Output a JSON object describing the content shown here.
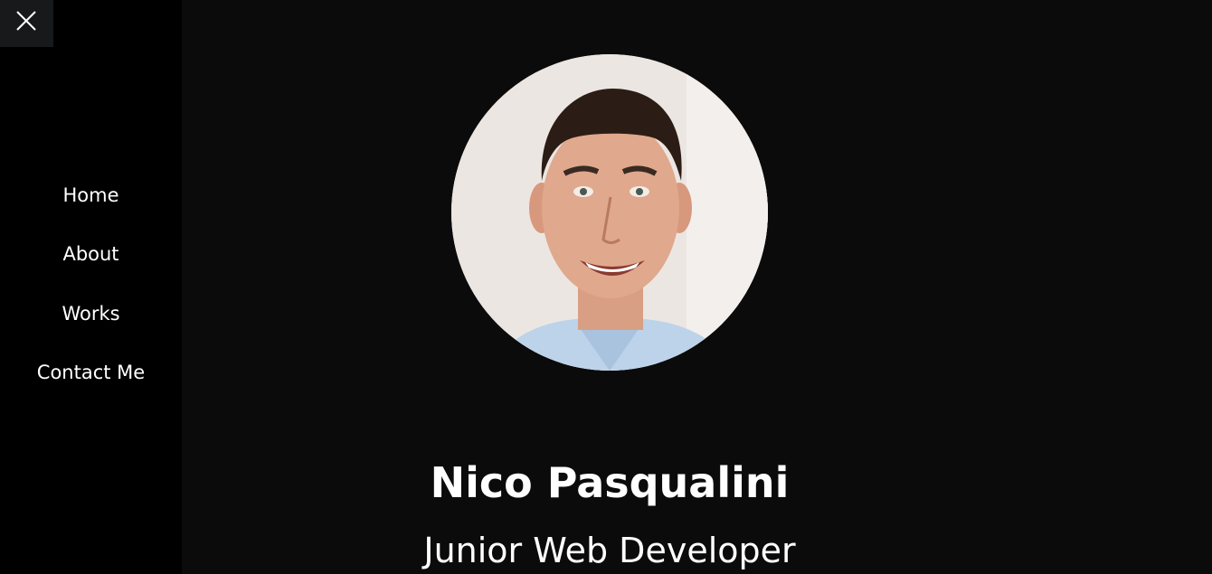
{
  "sidebar": {
    "close_icon": "close-icon",
    "items": [
      {
        "label": "Home"
      },
      {
        "label": "About"
      },
      {
        "label": "Works"
      },
      {
        "label": "Contact Me"
      }
    ]
  },
  "hero": {
    "name": "Nico Pasqualini",
    "role": "Junior Web Developer"
  },
  "colors": {
    "background": "#0b0b0c",
    "sidebar": "#000000",
    "close_button": "#17191b",
    "text": "#ffffff"
  }
}
